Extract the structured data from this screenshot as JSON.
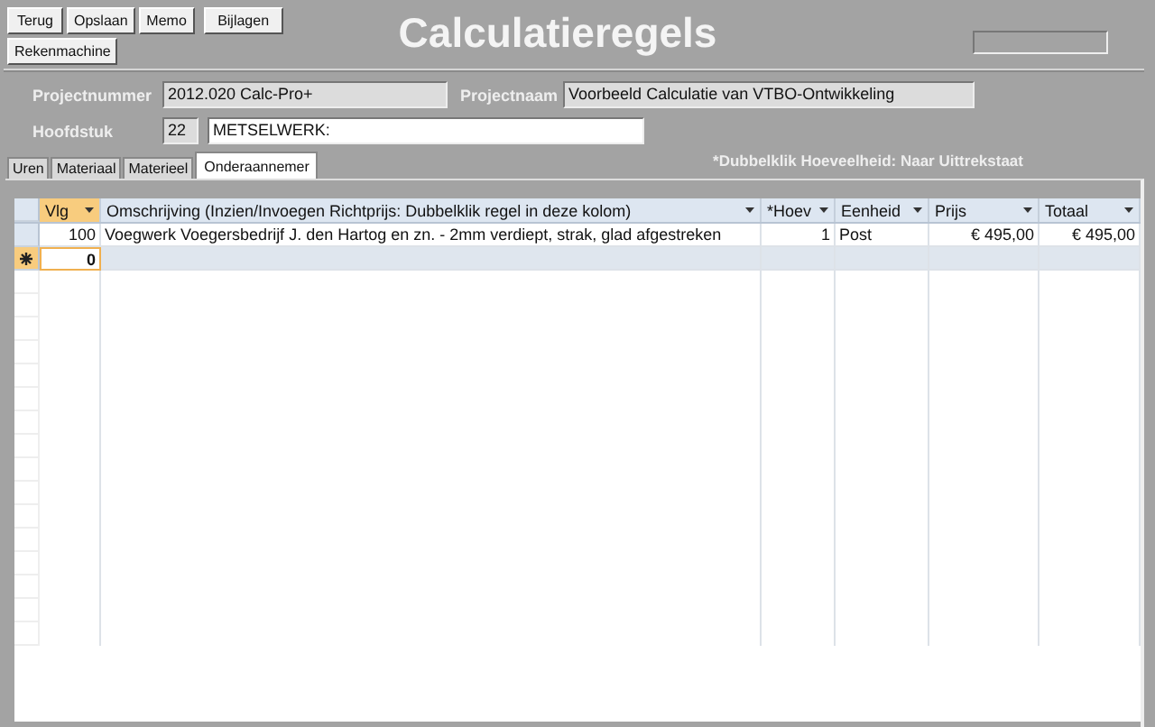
{
  "toolbar": {
    "buttons": [
      {
        "label": "Terug"
      },
      {
        "label": "Opslaan"
      },
      {
        "label": "Memo"
      },
      {
        "label": "Bijlagen"
      }
    ],
    "extra_button": "Rekenmachine"
  },
  "title": "Calculatieregels",
  "fields": {
    "projectnummer": {
      "label": "Projectnummer",
      "value": "2012.020 Calc-Pro+"
    },
    "projectnaam": {
      "label": "Projectnaam",
      "value": "Voorbeeld Calculatie van VTBO-Ontwikkeling"
    },
    "hoofdstuk": {
      "label": "Hoofdstuk",
      "code": "22",
      "value": "METSELWERK:"
    }
  },
  "tabs": [
    {
      "label": "Uren",
      "selected": false
    },
    {
      "label": "Materiaal",
      "selected": false
    },
    {
      "label": "Materieel",
      "selected": false
    },
    {
      "label": "Onderaannemer",
      "selected": true
    }
  ],
  "note": "*Dubbelklik Hoeveelheid: Naar Uittrekstaat",
  "table": {
    "columns": [
      {
        "label": "Vlg",
        "active": true
      },
      {
        "label": "Omschrijving (Inzien/Invoegen Richtprijs: Dubbelklik regel in deze kolom)",
        "active": false
      },
      {
        "label": "*Hoev",
        "active": false
      },
      {
        "label": "Eenheid",
        "active": false
      },
      {
        "label": "Prijs",
        "active": false
      },
      {
        "label": "Totaal",
        "active": false
      }
    ],
    "rows": [
      {
        "kind": "record",
        "selected": false,
        "cells": [
          "100",
          "Voegwerk Voegersbedrijf J. den Hartog en zn. - 2mm verdiept, strak, glad afgestreken",
          "1",
          "Post",
          "€ 495,00",
          "€ 495,00"
        ]
      },
      {
        "kind": "new",
        "selected": true,
        "cells": [
          "0",
          "",
          "",
          "",
          "",
          ""
        ]
      }
    ]
  }
}
